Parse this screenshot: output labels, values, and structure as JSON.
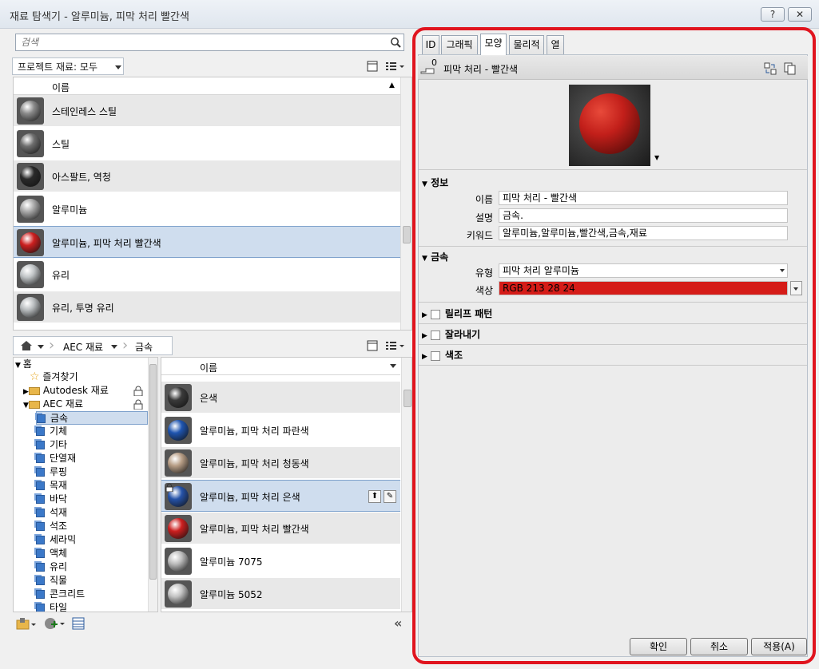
{
  "window": {
    "title": "재료 탐색기 - 알루미늄, 피막 처리 빨간색",
    "help": "?",
    "close": "✕"
  },
  "search": {
    "placeholder": "검색"
  },
  "project": {
    "filter_label": "프로젝트 재료: 모두",
    "column_name": "이름",
    "items": [
      {
        "label": "스테인레스 스틸",
        "color": "#8a8a8a"
      },
      {
        "label": "스틸",
        "color": "#6e6e6e"
      },
      {
        "label": "아스팔트, 역청",
        "color": "#2a2a2a"
      },
      {
        "label": "알루미늄",
        "color": "#a8a8a8"
      },
      {
        "label": "알루미늄, 피막 처리 빨간색",
        "color": "#cc1f1f"
      },
      {
        "label": "유리",
        "color": "#c0c4c6"
      },
      {
        "label": "유리, 투명 유리",
        "color": "#b8bcbe"
      }
    ]
  },
  "library": {
    "breadcrumb": [
      "AEC 재료",
      "금속"
    ],
    "tree": {
      "home": "홈",
      "favorites": "즐겨찾기",
      "autodesk": "Autodesk 재료",
      "aec": "AEC 재료",
      "categories": [
        "금속",
        "기체",
        "기타",
        "단열재",
        "루핑",
        "목재",
        "바닥",
        "석재",
        "석조",
        "세라믹",
        "액체",
        "유리",
        "직물",
        "콘크리트",
        "타일"
      ]
    },
    "column_name": "이름",
    "items": [
      {
        "label": "은색",
        "color": "#3a3a3a"
      },
      {
        "label": "알루미늄, 피막 처리 파란색",
        "color": "#1f55b0"
      },
      {
        "label": "알루미늄, 피막 처리 청동색",
        "color": "#b89e86"
      },
      {
        "label": "알루미늄, 피막 처리 은색",
        "color": "#2552a8"
      },
      {
        "label": "알루미늄, 피막 처리 빨간색",
        "color": "#cc1f1f"
      },
      {
        "label": "알루미늄 7075",
        "color": "#bdbdbd"
      },
      {
        "label": "알루미늄 5052",
        "color": "#c4c4c4"
      }
    ]
  },
  "editor": {
    "tabs": [
      "ID",
      "그래픽",
      "모양",
      "물리적",
      "열"
    ],
    "asset_name": "피막 처리 - 빨간색",
    "asset_count": "0",
    "info": {
      "title": "정보",
      "name_label": "이름",
      "name_value": "피막 처리 - 빨간색",
      "desc_label": "설명",
      "desc_value": "금속.",
      "kw_label": "키워드",
      "kw_value": "알루미늄,알루미늄,빨간색,금속,재료"
    },
    "metal": {
      "title": "금속",
      "type_label": "유형",
      "type_value": "피막 처리 알루미늄",
      "color_label": "색상",
      "color_value": "RGB 213 28 24",
      "color_hex": "#d51c18"
    },
    "collapsed": [
      "릴리프 패턴",
      "잘라내기",
      "색조"
    ]
  },
  "buttons": {
    "ok": "확인",
    "cancel": "취소",
    "apply": "적용(A)"
  }
}
